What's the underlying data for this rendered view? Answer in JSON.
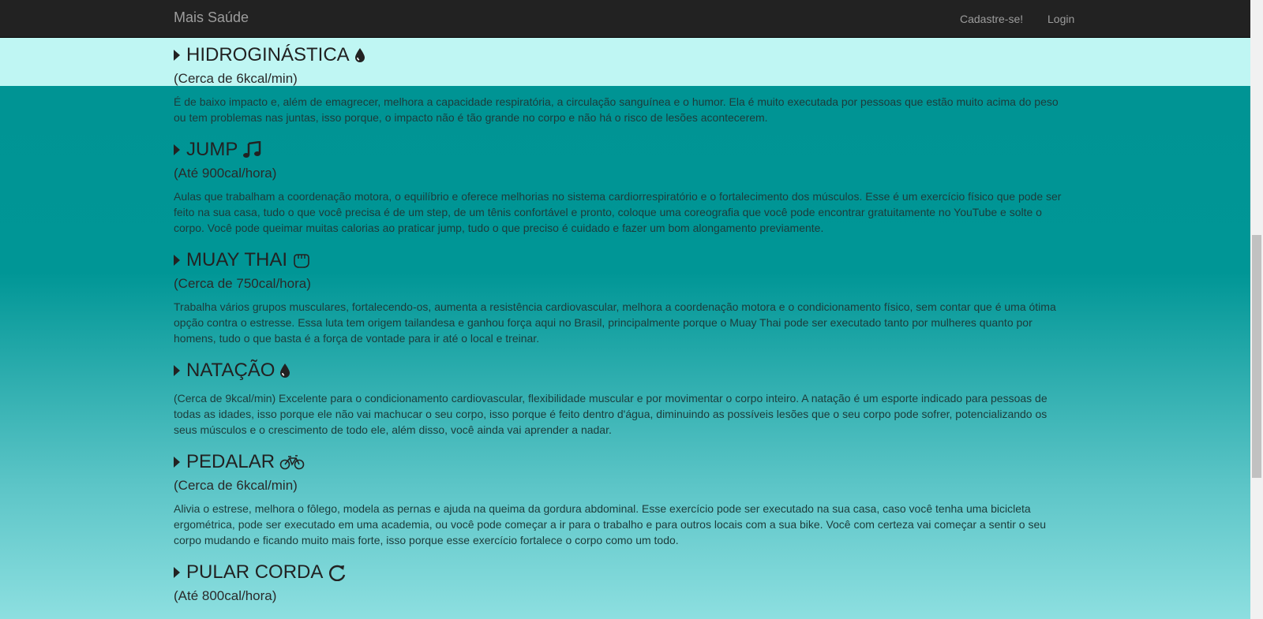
{
  "navbar": {
    "brand": "Mais Saúde",
    "signup": "Cadastre-se!",
    "login": "Login"
  },
  "sections": [
    {
      "title": "HIDROGINÁSTICA",
      "icon": "water-drop-icon",
      "calories": "(Cerca de 6kcal/min)",
      "description": "É de baixo impacto e, além de emagrecer, melhora a capacidade respiratória, a circulação sanguínea e o humor. Ela é muito executada por pessoas que estão muito acima do peso ou tem problemas nas juntas, isso porque, o impacto não é tão grande no corpo e não há o risco de lesões acontecerem."
    },
    {
      "title": "JUMP",
      "icon": "music-note-icon",
      "calories": "(Até 900cal/hora)",
      "description": "Aulas que trabalham a coordenação motora, o equilíbrio e oferece melhorias no sistema cardiorrespiratório e o fortalecimento dos músculos. Esse é um exercício físico que pode ser feito na sua casa, tudo o que você precisa é de um step, de um tênis confortável e pronto, coloque uma coreografia que você pode encontrar gratuitamente no YouTube e solte o corpo. Você pode queimar muitas calorias ao praticar jump, tudo o que preciso é cuidado e fazer um bom alongamento previamente."
    },
    {
      "title": "MUAY THAI",
      "icon": "fist-icon",
      "calories": "(Cerca de 750cal/hora)",
      "description": "Trabalha vários grupos musculares, fortalecendo-os, aumenta a resistência cardiovascular, melhora a coordenação motora e o condicionamento físico, sem contar que é uma ótima opção contra o estresse. Essa luta tem origem tailandesa e ganhou força aqui no Brasil, principalmente porque o Muay Thai pode ser executado tanto por mulheres quanto por homens, tudo o que basta é a força de vontade para ir até o local e treinar."
    },
    {
      "title": "NATAÇÃO",
      "icon": "water-drop-icon",
      "calories": "",
      "description": "(Cerca de 9kcal/min) Excelente para o condicionamento cardiovascular, flexibilidade muscular e por movimentar o corpo inteiro. A natação é um esporte indicado para pessoas de todas as idades, isso porque ele não vai machucar o seu corpo, isso porque é feito dentro d'água, diminuindo as possíveis lesões que o seu corpo pode sofrer, potencializando os seus músculos e o crescimento de todo ele, além disso, você ainda vai aprender a nadar."
    },
    {
      "title": "PEDALAR",
      "icon": "bicycle-icon",
      "calories": "(Cerca de 6kcal/min)",
      "description": "Alivia o estrese, melhora o fôlego, modela as pernas e ajuda na queima da gordura abdominal. Esse exercício pode ser executado na sua casa, caso você tenha uma bicicleta ergométrica, pode ser executado em uma academia, ou você pode começar a ir para o trabalho e para outros locais com a sua bike. Você com certeza vai começar a sentir o seu corpo mudando e ficando muito mais forte, isso porque esse exercício fortalece o corpo como um todo."
    },
    {
      "title": "PULAR CORDA",
      "icon": "refresh-icon",
      "calories": "(Até 800cal/hora)",
      "description": ""
    }
  ]
}
